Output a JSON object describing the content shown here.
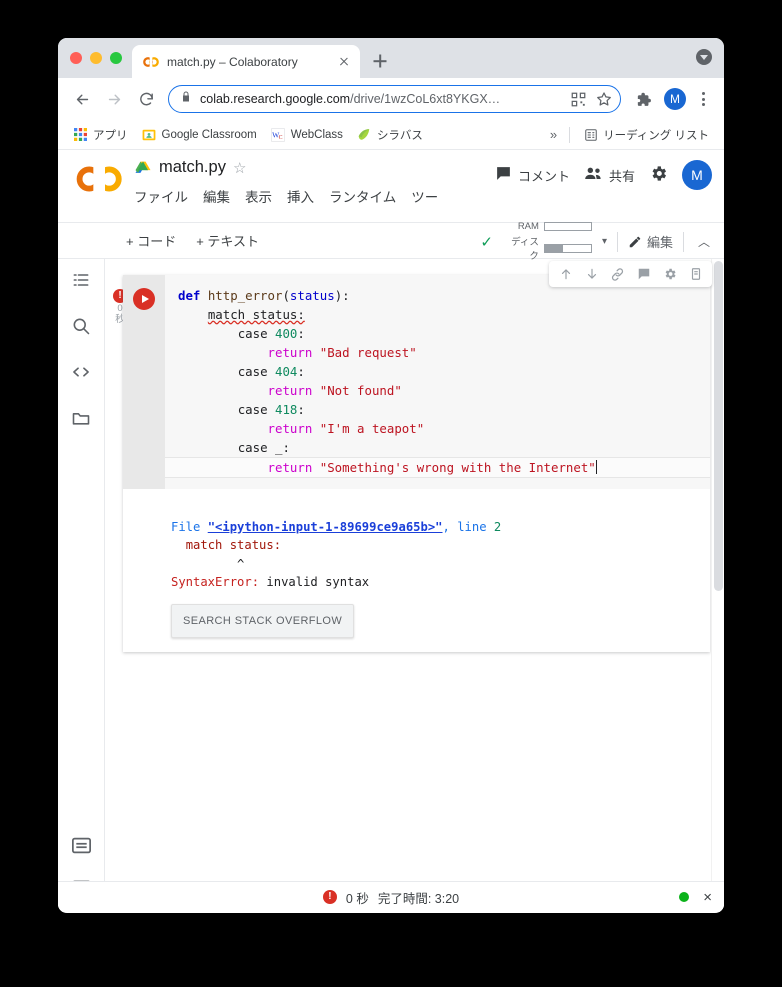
{
  "browser": {
    "window_controls": [
      "close",
      "minimize",
      "maximize"
    ],
    "tab": {
      "title": "match.py – Colaboratory",
      "favicon": "colab-icon",
      "close_label": "×"
    },
    "new_tab_label": "+",
    "tab_search_icon": "tab-search-icon",
    "nav": {
      "back_label": "←",
      "forward_label": "→",
      "reload_label": "⟳"
    },
    "omnibox": {
      "lock_icon": "lock-icon",
      "url_visible": "colab.research.google.com",
      "url_path": "/drive/1wzCoL6xt8YKGX…",
      "qr_icon": "qr-code-icon",
      "bookmark_icon": "star-icon"
    },
    "extensions_icon": "puzzle-icon",
    "profile_initial": "M",
    "menu_icon": "kebab-menu-icon",
    "bookmarks": [
      {
        "label": "アプリ",
        "icon": "apps-grid-icon"
      },
      {
        "label": "Google Classroom",
        "icon": "classroom-icon"
      },
      {
        "label": "WebClass",
        "icon": "webclass-icon"
      },
      {
        "label": "シラバス",
        "icon": "syllabus-icon"
      }
    ],
    "bookmarks_overflow": "»",
    "reading_list": {
      "label": "リーディング リスト",
      "icon": "reading-list-icon"
    }
  },
  "colab": {
    "logo": "colab-logo",
    "document": {
      "drive_icon": "google-drive-icon",
      "title": "match.py",
      "star_icon": "☆"
    },
    "menu": [
      "ファイル",
      "編集",
      "表示",
      "挿入",
      "ランタイム",
      "ツー"
    ],
    "header_actions": {
      "comment": {
        "label": "コメント",
        "icon": "comment-icon"
      },
      "share": {
        "label": "共有",
        "icon": "people-icon"
      },
      "settings_icon": "gear-icon",
      "avatar_initial": "M"
    },
    "toolbar": {
      "add_code": "+ コード",
      "add_text": "+ テキスト",
      "connected_check": "✓",
      "ram_label": "RAM",
      "disk_label": "ディスク",
      "ram_fill_pct": 0,
      "disk_fill_pct": 40,
      "dropdown_caret": "▾",
      "edit_label": "編集",
      "collapse_caret": "︿"
    },
    "rail": {
      "top_icons": [
        "table-of-contents-icon",
        "search-icon",
        "code-snippets-icon",
        "files-icon"
      ],
      "bottom_icons": [
        "command-palette-icon",
        "terminal-icon"
      ]
    },
    "cell": {
      "error_badge": "!",
      "gutter_time": "0\n秒",
      "run_button": "run-cell-button",
      "toolbar_icons": [
        "move-cell-up-icon",
        "move-cell-down-icon",
        "link-to-cell-icon",
        "add-comment-icon",
        "cell-settings-icon",
        "delete-cell-icon"
      ],
      "code_lines": [
        {
          "indent": 0,
          "tokens": [
            {
              "t": "def ",
              "c": "k-def"
            },
            {
              "t": "http_error",
              "c": "k-fn"
            },
            {
              "t": "(",
              "c": "k-plain"
            },
            {
              "t": "status",
              "c": "k-param"
            },
            {
              "t": "):",
              "c": "k-plain"
            }
          ]
        },
        {
          "indent": 1,
          "tokens": [
            {
              "t": "match status:",
              "c": "squig"
            }
          ]
        },
        {
          "indent": 2,
          "tokens": [
            {
              "t": "case ",
              "c": "k-plain"
            },
            {
              "t": "400",
              "c": "k-num"
            },
            {
              "t": ":",
              "c": "k-plain"
            }
          ]
        },
        {
          "indent": 3,
          "tokens": [
            {
              "t": "return ",
              "c": "k-kw"
            },
            {
              "t": "\"Bad request\"",
              "c": "k-str"
            }
          ]
        },
        {
          "indent": 2,
          "tokens": [
            {
              "t": "case ",
              "c": "k-plain"
            },
            {
              "t": "404",
              "c": "k-num"
            },
            {
              "t": ":",
              "c": "k-plain"
            }
          ]
        },
        {
          "indent": 3,
          "tokens": [
            {
              "t": "return ",
              "c": "k-kw"
            },
            {
              "t": "\"Not found\"",
              "c": "k-str"
            }
          ]
        },
        {
          "indent": 2,
          "tokens": [
            {
              "t": "case ",
              "c": "k-plain"
            },
            {
              "t": "418",
              "c": "k-num"
            },
            {
              "t": ":",
              "c": "k-plain"
            }
          ]
        },
        {
          "indent": 3,
          "tokens": [
            {
              "t": "return ",
              "c": "k-kw"
            },
            {
              "t": "\"I'm a teapot\"",
              "c": "k-str"
            }
          ]
        },
        {
          "indent": 2,
          "tokens": [
            {
              "t": "case _:",
              "c": "k-plain"
            }
          ]
        },
        {
          "indent": 3,
          "active": true,
          "tokens": [
            {
              "t": "return ",
              "c": "k-kw"
            },
            {
              "t": "\"Something's wrong with the Internet\"",
              "c": "k-str"
            }
          ]
        }
      ],
      "code_plain": "def http_error(status):\n    match status:\n        case 400:\n            return \"Bad request\"\n        case 404:\n            return \"Not found\"\n        case 418:\n            return \"I'm a teapot\"\n        case _:\n            return \"Something's wrong with the Internet\"",
      "output": {
        "file_label": "File",
        "file_name": "\"<ipython-input-1-89699ce9a65b>\"",
        "comma": ",",
        "line_label": " line ",
        "line_number": "2",
        "source_line": "match status:",
        "caret_marker": "^",
        "error_name": "SyntaxError:",
        "error_message": " invalid syntax",
        "stack_overflow_button": "SEARCH STACK OVERFLOW"
      }
    },
    "statusbar": {
      "error_icon": "!",
      "duration": "0 秒",
      "finish_time": "完了時間: 3:20",
      "connection_dot": "connected-dot",
      "close_icon": "×"
    }
  },
  "colors": {
    "colab_orange": "#F9AB00",
    "accent_blue": "#1a73e8",
    "error_red": "#d93025",
    "success_green": "#0f9d58",
    "string_red": "#bd1421",
    "keyword_purple": "#cc00cc",
    "number_green": "#0f8a5f"
  }
}
